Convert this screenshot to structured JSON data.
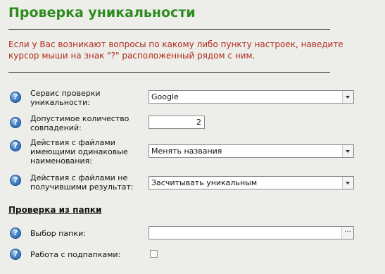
{
  "page": {
    "title": "Проверка уникальности",
    "notice": "Если у Вас возникают вопросы по какому либо пункту настроек, наведите курсор мыши на знак \"?\" расположенный рядом с ним."
  },
  "help_glyph": "?",
  "settings": {
    "service_label": "Сервис проверки уникальности:",
    "service_value": "Google",
    "matches_label": "Допустимое количество совпадений:",
    "matches_value": "2",
    "same_names_label": "Действия с файлами имеющими одинаковые наименования:",
    "same_names_value": "Менять названия",
    "no_result_label": "Действия с файлами не получившими результат:",
    "no_result_value": "Засчитывать уникальным"
  },
  "folder_section": {
    "heading": "Проверка из папки",
    "folder_label": "Выбор папки:",
    "folder_value": "",
    "browse_label": "···",
    "subfolders_label": "Работа с подпапками:",
    "subfolders_checked": false
  },
  "colors": {
    "title": "#2d8c1e",
    "notice": "#b02a1a",
    "background": "#edeeea"
  },
  "icons": [
    "help-icon",
    "dropdown-arrow-icon",
    "browse-icon",
    "checkbox"
  ]
}
